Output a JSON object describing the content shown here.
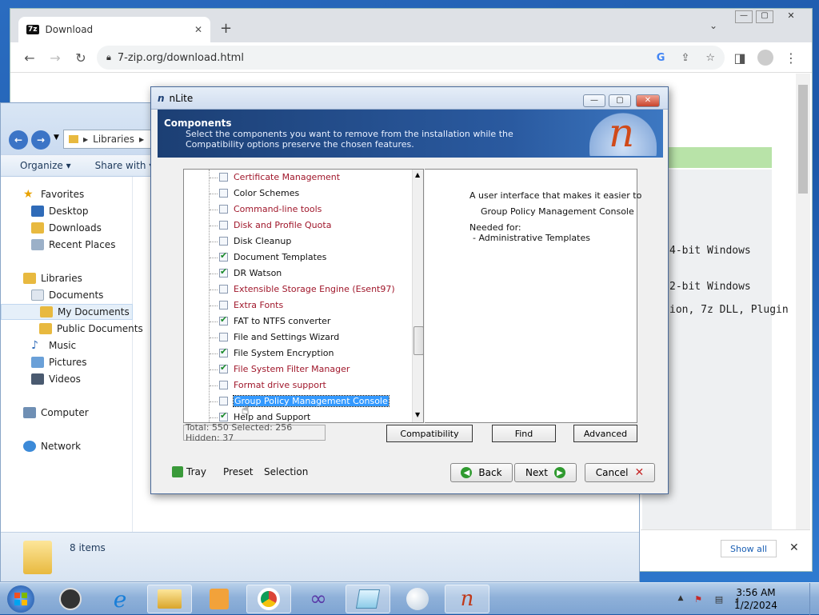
{
  "chrome": {
    "tab_title": "Download",
    "tab_favicon": "7z",
    "url": "7-zip.org/download.html",
    "page_lines": [
      "4-bit Windows",
      "2-bit Windows",
      "ion, 7z DLL, Plugin"
    ],
    "download_bar_button": "Show all"
  },
  "explorer": {
    "breadcrumb": "Libraries",
    "toolbar": {
      "organize": "Organize",
      "share": "Share with"
    },
    "nav": {
      "favorites": "Favorites",
      "desktop": "Desktop",
      "downloads": "Downloads",
      "recent": "Recent Places",
      "libraries": "Libraries",
      "documents": "Documents",
      "my_documents": "My Documents",
      "public_documents": "Public Documents",
      "music": "Music",
      "pictures": "Pictures",
      "videos": "Videos",
      "computer": "Computer",
      "network": "Network"
    },
    "details": "8 items"
  },
  "nlite": {
    "title": "nLite",
    "header_title": "Components",
    "header_desc": "Select the components you want to remove from the installation while the Compatibility options preserve the chosen features.",
    "tree": [
      {
        "label": "Certificate Management",
        "checked": false,
        "red": true
      },
      {
        "label": "Color Schemes",
        "checked": false,
        "red": false
      },
      {
        "label": "Command-line tools",
        "checked": false,
        "red": true
      },
      {
        "label": "Disk and Profile Quota",
        "checked": false,
        "red": true
      },
      {
        "label": "Disk Cleanup",
        "checked": false,
        "red": false
      },
      {
        "label": "Document Templates",
        "checked": true,
        "red": false
      },
      {
        "label": "DR Watson",
        "checked": true,
        "red": false
      },
      {
        "label": "Extensible Storage Engine (Esent97)",
        "checked": false,
        "red": true
      },
      {
        "label": "Extra Fonts",
        "checked": false,
        "red": true
      },
      {
        "label": "FAT to NTFS converter",
        "checked": true,
        "red": false
      },
      {
        "label": "File and Settings Wizard",
        "checked": false,
        "red": false
      },
      {
        "label": "File System Encryption",
        "checked": true,
        "red": false
      },
      {
        "label": "File System Filter Manager",
        "checked": true,
        "red": true
      },
      {
        "label": "Format drive support",
        "checked": false,
        "red": true
      },
      {
        "label": "Group Policy Management Console",
        "checked": false,
        "red": false,
        "selected": true
      },
      {
        "label": "Help and Support",
        "checked": true,
        "red": false
      }
    ],
    "description": {
      "line1": "A user interface that makes it easier to",
      "line2": "Group Policy Management Console",
      "needed_label": "Needed for:",
      "needed_item": "- Administrative Templates"
    },
    "status": "Total: 550 Selected: 256 Hidden: 37",
    "buttons": {
      "compatibility": "Compatibility",
      "find": "Find",
      "advanced": "Advanced"
    },
    "bottom": {
      "tray": "Tray",
      "preset": "Preset",
      "selection": "Selection",
      "back": "Back",
      "next": "Next",
      "cancel": "Cancel"
    }
  },
  "taskbar": {
    "time": "3:56 AM",
    "date": "1/2/2024"
  },
  "colors": {
    "tree_red": "#a0172b",
    "selection": "#3399ff",
    "header_blue": "#1c3f74"
  }
}
